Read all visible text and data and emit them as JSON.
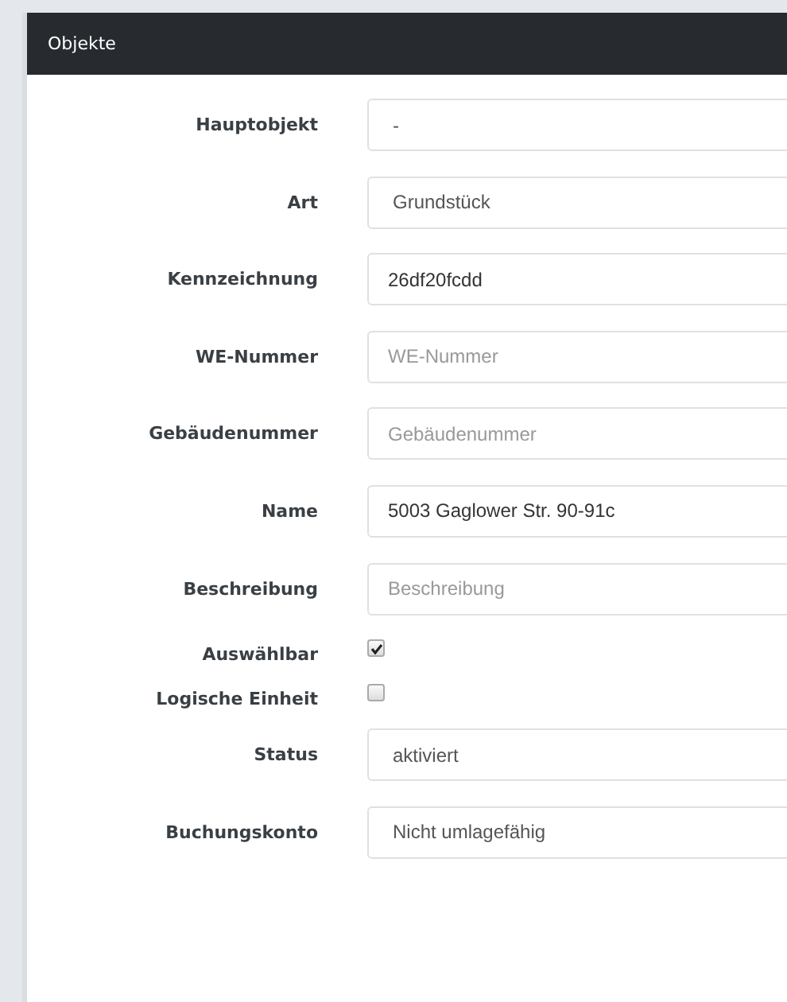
{
  "panel": {
    "title": "Objekte"
  },
  "fields": [
    {
      "label": "Hauptobjekt",
      "kind": "select",
      "value": "-"
    },
    {
      "label": "Art",
      "kind": "select",
      "value": "Grundstück"
    },
    {
      "label": "Kennzeichnung",
      "kind": "text",
      "value": "26df20fcdd"
    },
    {
      "label": "WE-Nummer",
      "kind": "text",
      "placeholder": "WE-Nummer"
    },
    {
      "label": "Gebäudenummer",
      "kind": "text",
      "placeholder": "Gebäudenummer"
    },
    {
      "label": "Name",
      "kind": "text",
      "value": "5003 Gaglower Str. 90-91c"
    },
    {
      "label": "Beschreibung",
      "kind": "text",
      "placeholder": "Beschreibung"
    },
    {
      "label": "Auswählbar",
      "kind": "checkbox",
      "checked": true
    },
    {
      "label": "Logische Einheit",
      "kind": "checkbox",
      "checked": false
    },
    {
      "label": "Status",
      "kind": "select",
      "value": "aktiviert"
    },
    {
      "label": "Buchungskonto",
      "kind": "select",
      "value": "Nicht umlagefähig"
    }
  ]
}
